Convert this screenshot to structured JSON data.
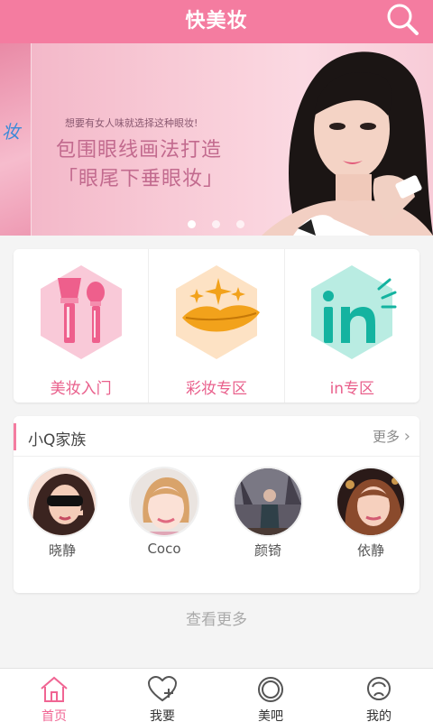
{
  "header": {
    "title": "快美妆"
  },
  "banner": {
    "side_text": "妆",
    "tagline": "想要有女人味就选择这种眼妆!",
    "headline_1": "包围眼线画法打造",
    "headline_2": "「眼尾下垂眼妆」",
    "slides_total": 3,
    "active_slide": 1
  },
  "categories": [
    {
      "label": "美妆入门",
      "icon": "brushes-icon",
      "color": "#f9c9d8"
    },
    {
      "label": "彩妆专区",
      "icon": "lips-sparkle-icon",
      "color": "#fde2c4"
    },
    {
      "label": "in专区",
      "icon": "in-icon",
      "color": "#b9ece2"
    }
  ],
  "family": {
    "title": "小Q家族",
    "more_label": "更多",
    "members": [
      {
        "name": "晓静"
      },
      {
        "name": "Coco"
      },
      {
        "name": "颜锜"
      },
      {
        "name": "依静"
      }
    ]
  },
  "see_more": "查看更多",
  "tabs": [
    {
      "label": "首页",
      "icon": "home-icon",
      "active": true
    },
    {
      "label": "我要",
      "icon": "heart-plus-icon",
      "active": false
    },
    {
      "label": "美吧",
      "icon": "ring-icon",
      "active": false
    },
    {
      "label": "我的",
      "icon": "user-icon",
      "active": false
    }
  ],
  "colors": {
    "brand": "#f47ca0",
    "accent_text": "#e9608c"
  }
}
